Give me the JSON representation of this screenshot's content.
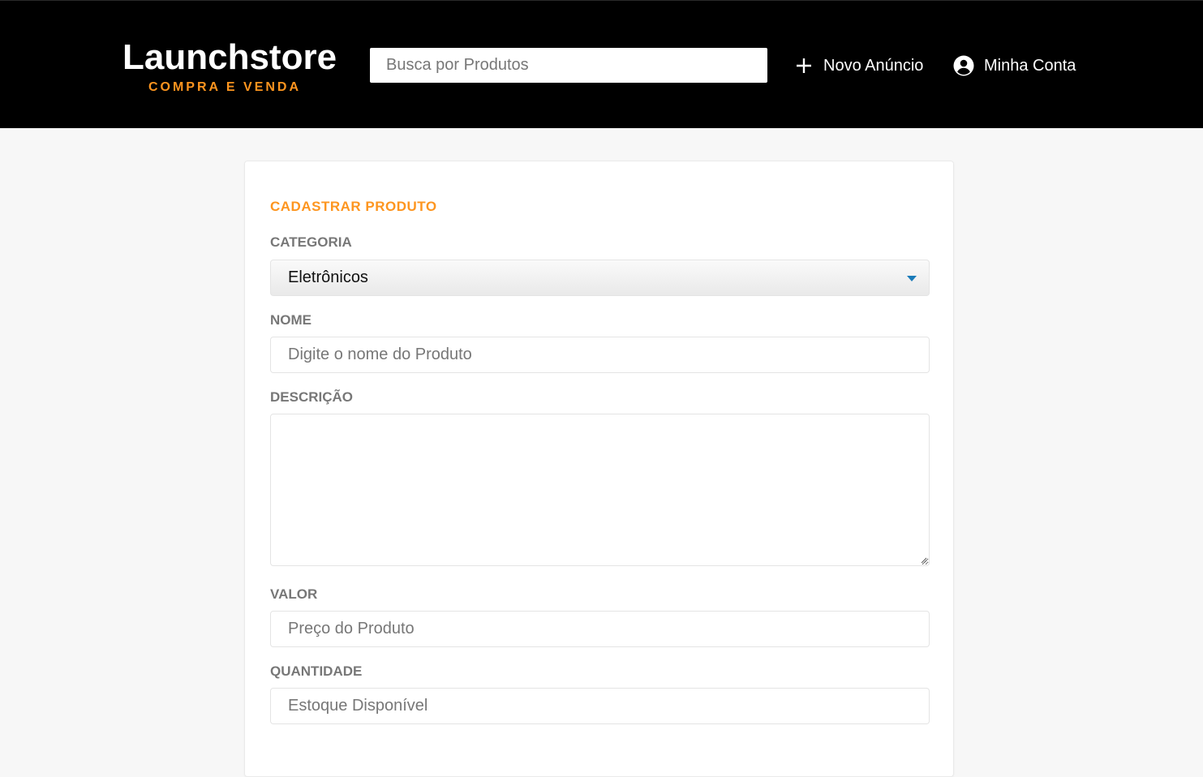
{
  "header": {
    "logo_title": "Launchstore",
    "logo_subtitle": "COMPRA E VENDA",
    "search_placeholder": "Busca por Produtos",
    "new_ad_label": "Novo Anúncio",
    "account_label": "Minha Conta"
  },
  "form": {
    "title": "CADASTRAR PRODUTO",
    "category": {
      "label": "CATEGORIA",
      "selected": "Eletrônicos"
    },
    "name": {
      "label": "NOME",
      "placeholder": "Digite o nome do Produto",
      "value": ""
    },
    "description": {
      "label": "DESCRIÇÃO",
      "value": ""
    },
    "price": {
      "label": "VALOR",
      "placeholder": "Preço do Produto",
      "value": ""
    },
    "quantity": {
      "label": "QUANTIDADE",
      "placeholder": "Estoque Disponível",
      "value": ""
    }
  },
  "colors": {
    "accent": "#fd951f",
    "header_bg": "#000000",
    "page_bg": "#f7f7f7",
    "select_arrow": "#1a7bb9"
  },
  "icons": {
    "new_ad": "plus-icon",
    "account": "account-circle-icon",
    "select": "caret-down-icon"
  }
}
